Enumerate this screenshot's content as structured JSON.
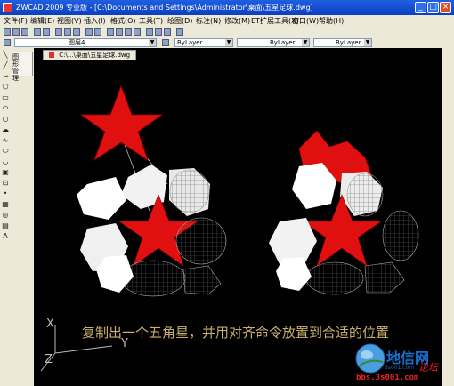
{
  "window": {
    "title": "ZWCAD 2009 专业版 - [C:\\Documents and Settings\\Administrator\\桌面\\五星足球.dwg]"
  },
  "menu": [
    "文件(F)",
    "编辑(E)",
    "视图(V)",
    "插入(I)",
    "格式(O)",
    "工具(T)",
    "绘图(D)",
    "标注(N)",
    "修改(M)",
    "ET扩展工具(X)",
    "窗口(W)",
    "帮助(H)"
  ],
  "properties_bar": {
    "layer": "图层4",
    "color": "ByLayer",
    "linetype": "ByLayer",
    "lineweight": "ByLayer"
  },
  "dock": {
    "label": "图形管理"
  },
  "document_tab": "C:\\...\\桌面\\五星足球.dwg",
  "canvas": {
    "caption": "复制出一个五角星，并用对齐命令放置到合适的位置",
    "ucs": {
      "x": "X",
      "y": "Y",
      "z": "Z"
    }
  },
  "watermark": {
    "title": "地信网",
    "domain_small": "3s001.com",
    "subtitle": "论坛",
    "url": "bbs.3s001.com"
  },
  "colors": {
    "star_red": "#e01010",
    "caption": "#c8b06a",
    "background": "#000000"
  }
}
